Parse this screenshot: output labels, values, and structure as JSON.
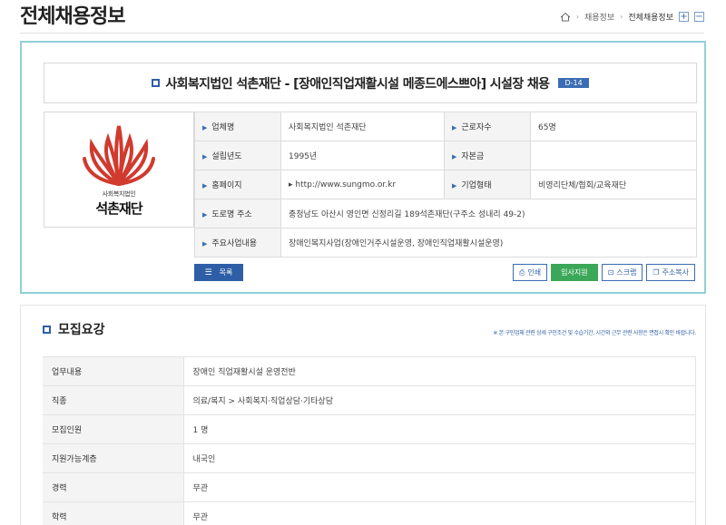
{
  "header": {
    "title": "전체채용정보",
    "breadcrumb": [
      "채용정보",
      "전체채용정보"
    ],
    "zoom_in": "+",
    "zoom_out": "−"
  },
  "job": {
    "title": "사회복지법인 석촌재단 - [장애인직업재활시설 메종드에스쁘아] 시설장 채용",
    "badge": "D-14"
  },
  "logo": {
    "subtitle": "사회복지법인",
    "name": "석촌재단",
    "colors": {
      "primary": "#d13a2e"
    }
  },
  "company": {
    "rows": [
      {
        "label": "업체명",
        "value": "사회복지법인 석촌재단",
        "label2": "근로자수",
        "value2": "65명"
      },
      {
        "label": "설립년도",
        "value": "1995년",
        "label2": "자본금",
        "value2": ""
      },
      {
        "label": "홈페이지",
        "value": "http://www.sungmo.or.kr",
        "label2": "기업형태",
        "value2": "비영리단체/협회/교육재단"
      },
      {
        "label": "도로명 주소",
        "value": "충청남도 아산시 영인면 신정리길 189석촌재단(구주소 성내리 49-2)"
      },
      {
        "label": "주요사업내용",
        "value": "장애인복지사업(장애인거주시설운영, 장애인직업재활시설운영)"
      }
    ]
  },
  "actions": {
    "list": "목록",
    "print": "인쇄",
    "apply": "입사지원",
    "scrap": "스크랩",
    "copy_address": "주소복사"
  },
  "recruit": {
    "title": "모집요강",
    "note": "※ 본 구인업체 관련 상세 구인조건 및 수습기간, 시간외 근무 관련 사항은 면접시 확인 바랍니다.",
    "rows": [
      {
        "label": "업무내용",
        "value": "장애인 직업재활시설 운영전반"
      },
      {
        "label": "직종",
        "value": "의료/복지 > 사회복지·직업상담·기타상담"
      },
      {
        "label": "모집인원",
        "value": "1 명"
      },
      {
        "label": "지원가능계층",
        "value": "내국인"
      },
      {
        "label": "경력",
        "value": "무관"
      },
      {
        "label": "학력",
        "value": "무관"
      }
    ]
  },
  "colors": {
    "accent": "#2e5fa6",
    "border_cyan": "#8fd1d8",
    "apply_green": "#3aa858"
  }
}
